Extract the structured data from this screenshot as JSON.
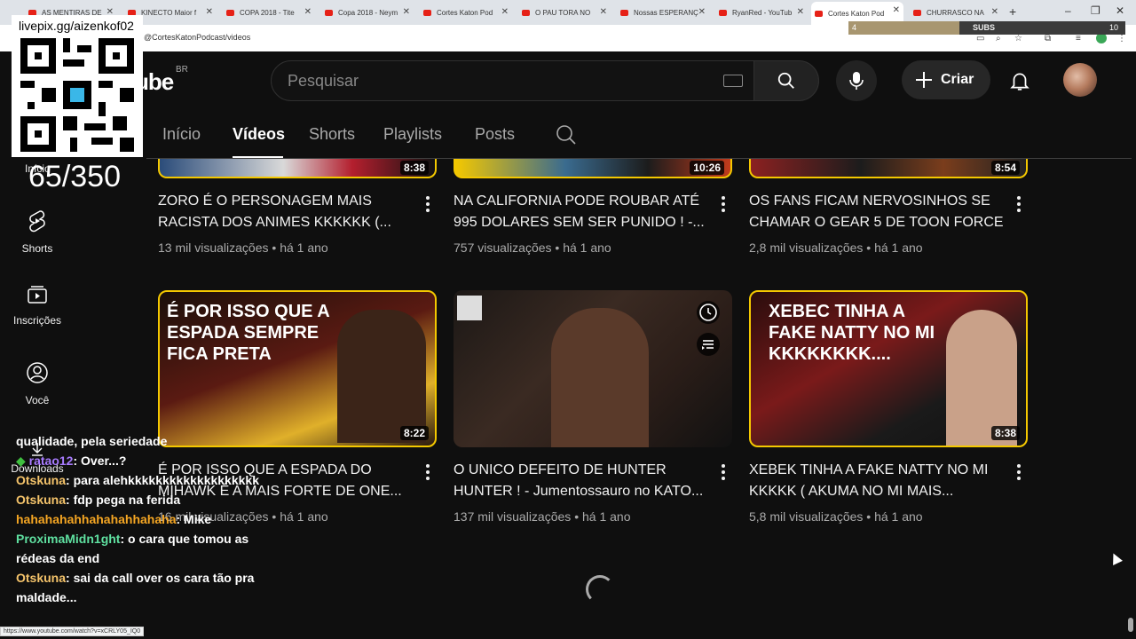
{
  "browser": {
    "tabs": [
      {
        "label": "AS MENTIRAS DE"
      },
      {
        "label": "KINECTO Maior f"
      },
      {
        "label": "COPA 2018 - Tite"
      },
      {
        "label": "Copa 2018 - Neym"
      },
      {
        "label": "Cortes Katon Pod"
      },
      {
        "label": "O PAU TORA NO"
      },
      {
        "label": "Nossas ESPERANÇ"
      },
      {
        "label": "RyanRed - YouTub"
      },
      {
        "label": "Cortes Katon Pod"
      },
      {
        "label": "CHURRASCO NA"
      }
    ],
    "active_tab_index": 8,
    "new_tab": "+",
    "url": "@CortesKatonPodcast/videos",
    "window_controls": [
      "–",
      "❐",
      "✕"
    ],
    "status_url": "https://www.youtube.com/watch?v=xCRLY05_IQ0"
  },
  "subs_goal": {
    "current": "4",
    "label": "SUBS",
    "goal": "10",
    "progress": 0.4
  },
  "youtube": {
    "logo": "ube",
    "region": "BR",
    "search_placeholder": "Pesquisar",
    "create_label": "Criar"
  },
  "channel_tabs": [
    "Início",
    "Vídeos",
    "Shorts",
    "Playlists",
    "Posts"
  ],
  "active_channel_tab": "Vídeos",
  "guide": {
    "home": "Início",
    "shorts": "Shorts",
    "subscriptions": "Inscrições",
    "you": "Você",
    "downloads": "Downloads"
  },
  "videos_row1": [
    {
      "title": "ZORO É O PERSONAGEM MAIS RACISTA DOS ANIMES KKKKKK (...",
      "views": "13 mil visualizações",
      "age": "há 1 ano",
      "duration": "8:38"
    },
    {
      "title": "NA CALIFORNIA PODE ROUBAR ATÉ 995 DOLARES SEM SER PUNIDO ! -...",
      "views": "757 visualizações",
      "age": "há 1 ano",
      "duration": "10:26"
    },
    {
      "title": "OS FANS FICAM NERVOSINHOS SE CHAMAR O GEAR 5 DE TOON FORCE ...",
      "views": "2,8 mil visualizações",
      "age": "há 1 ano",
      "duration": "8:54"
    }
  ],
  "videos_row2": [
    {
      "title": "É POR ISSO QUE A ESPADA DO MIHAWK É A MAIS FORTE DE ONE...",
      "views": "16 mil visualizações",
      "age": "há 1 ano",
      "duration": "8:22",
      "thumb_text": "É POR ISSO QUE A ESPADA SEMPRE FICA PRETA"
    },
    {
      "title": "O UNICO DEFEITO DE HUNTER HUNTER ! - Jumentossauro no KATO...",
      "views": "137 mil visualizações",
      "age": "há 1 ano",
      "duration": ""
    },
    {
      "title": "XEBEK TINHA A FAKE NATTY NO MI KKKKK ( AKUMA NO MI MAIS...",
      "views": "5,8 mil visualizações",
      "age": "há 1 ano",
      "duration": "8:38",
      "thumb_text": "XEBEC TINHA A FAKE NATTY NO MI KKKKKKKK...."
    }
  ],
  "meta_sep": "•",
  "overlay": {
    "qr_url": "livepix.gg/aizenkof02",
    "counter": "65/350",
    "chat": [
      {
        "user": "",
        "text": "qualidade, pela seriedade",
        "color": "#ffffff"
      },
      {
        "user": "ratao12",
        "text": "Over...?",
        "color": "#a87bff"
      },
      {
        "user": "Otskuna",
        "text": "para alehkkkkkkkkkkkkkkkkkkk",
        "color": "#f5c46b"
      },
      {
        "user": "Otskuna",
        "text": "fdp pega na ferida",
        "color": "#f5c46b"
      },
      {
        "user": "hahahahahhahahahhahaha",
        "text": "Mike",
        "color": "#f5a623"
      },
      {
        "user": "ProximaMidn1ght",
        "text": "o cara que tomou as rédeas da end",
        "color": "#5fe0a0"
      },
      {
        "user": "Otskuna",
        "text": "sai da call over os cara tão pra maldade...",
        "color": "#f5c46b"
      }
    ]
  }
}
